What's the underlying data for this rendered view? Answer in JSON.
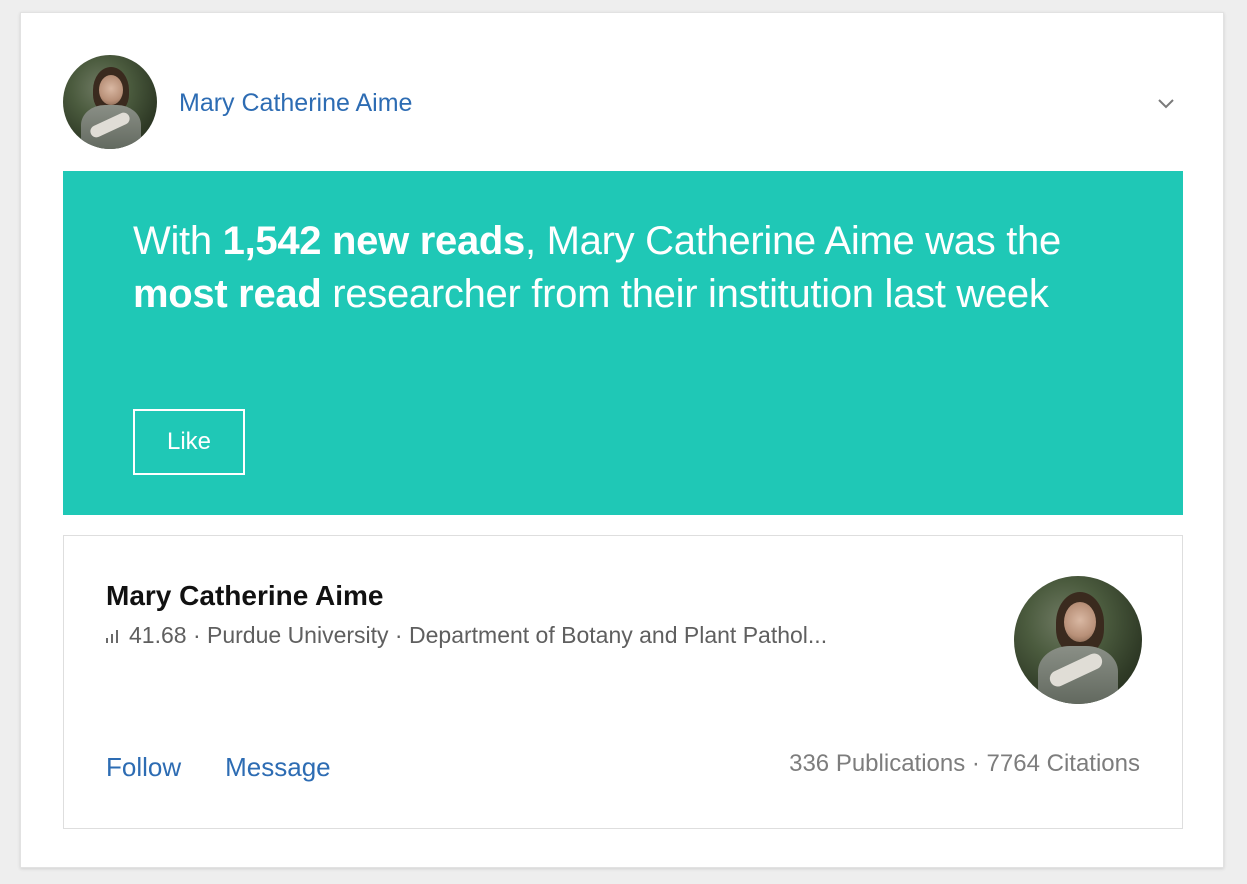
{
  "header": {
    "author_name": "Mary Catherine Aime",
    "avatar_icon": "avatar-photo",
    "menu_icon": "chevron-down-icon"
  },
  "banner": {
    "text_parts": {
      "p1": "With ",
      "b1": "1,542 new reads",
      "p2": ", Mary Catherine Aime was the ",
      "b2": "most read",
      "p3": " researcher from their institution last week"
    },
    "like_label": "Like",
    "background_color": "#1fc8b6"
  },
  "profile": {
    "name": "Mary Catherine Aime",
    "score_icon": "bar-chart-icon",
    "score": "41.68",
    "separator": " · ",
    "institution": "Purdue University",
    "department": "Department of Botany and Plant Pathol...",
    "follow_label": "Follow",
    "message_label": "Message",
    "stats": "336 Publications · 7764 Citations"
  },
  "colors": {
    "link": "#2d6cb3",
    "banner": "#1fc8b6"
  }
}
